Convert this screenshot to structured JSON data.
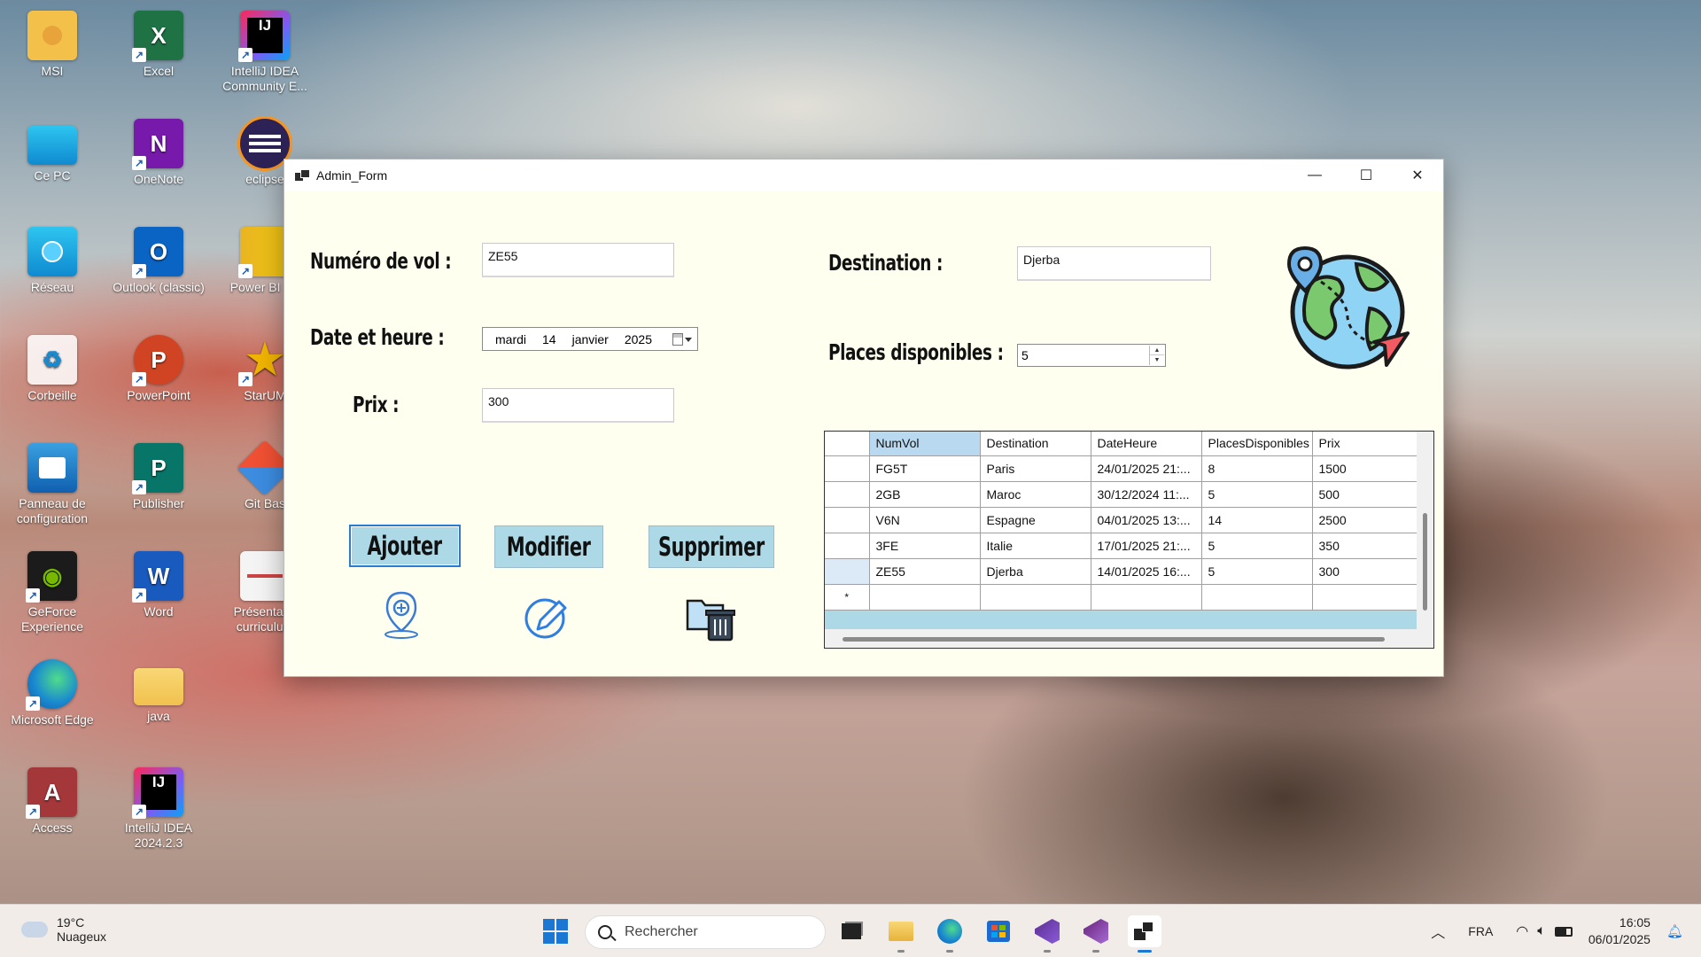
{
  "desktop": {
    "icons": [
      {
        "label": "MSI"
      },
      {
        "label": "Excel"
      },
      {
        "label": "IntelliJ IDEA Community E..."
      },
      {
        "label": "Ce PC"
      },
      {
        "label": "OneNote"
      },
      {
        "label": "eclipse"
      },
      {
        "label": "Réseau"
      },
      {
        "label": "Outlook (classic)"
      },
      {
        "label": "Power BI De"
      },
      {
        "label": "Corbeille"
      },
      {
        "label": "PowerPoint"
      },
      {
        "label": "StarUM"
      },
      {
        "label": "Panneau de configuration"
      },
      {
        "label": "Publisher"
      },
      {
        "label": "Git Bas"
      },
      {
        "label": "GeForce Experience"
      },
      {
        "label": "Word"
      },
      {
        "label": "Présentatio curriculum"
      },
      {
        "label": "Microsoft Edge"
      },
      {
        "label": "java"
      },
      {
        "label": "Access"
      },
      {
        "label": "IntelliJ IDEA 2024.2.3"
      }
    ]
  },
  "window": {
    "title": "Admin_Form",
    "controls": {
      "minimize": "—",
      "maximize": "☐",
      "close": "✕"
    }
  },
  "form": {
    "numero_label": "Numéro de vol :",
    "numero_value": "ZE55",
    "date_label": "Date et heure :",
    "date_parts": {
      "day_name": "mardi",
      "day": "14",
      "month": "janvier",
      "year": "2025"
    },
    "prix_label": "Prix :",
    "prix_value": "300",
    "destination_label": "Destination :",
    "destination_value": "Djerba",
    "places_label": "Places disponibles :",
    "places_value": "5"
  },
  "buttons": {
    "ajouter": "Ajouter",
    "modifier": "Modifier",
    "supprimer": "Supprimer"
  },
  "grid": {
    "columns": [
      "NumVol",
      "Destination",
      "DateHeure",
      "PlacesDisponibles",
      "Prix"
    ],
    "rows": [
      [
        "FG5T",
        "Paris",
        "24/01/2025 21:...",
        "8",
        "1500"
      ],
      [
        "2GB",
        "Maroc",
        "30/12/2024 11:...",
        "5",
        "500"
      ],
      [
        "V6N",
        "Espagne",
        "04/01/2025 13:...",
        "14",
        "2500"
      ],
      [
        "3FE",
        "Italie",
        "17/01/2025 21:...",
        "5",
        "350"
      ],
      [
        "ZE55",
        "Djerba",
        "14/01/2025 16:...",
        "5",
        "300"
      ]
    ],
    "new_row_marker": "*"
  },
  "taskbar": {
    "weather_temp": "19°C",
    "weather_desc": "Nuageux",
    "search_placeholder": "Rechercher",
    "language": "FRA",
    "time": "16:05",
    "date": "06/01/2025"
  },
  "colors": {
    "form_bg": "#fffff0",
    "button_bg": "#add8e6",
    "grid_header_selected": "#b8d9f0"
  }
}
